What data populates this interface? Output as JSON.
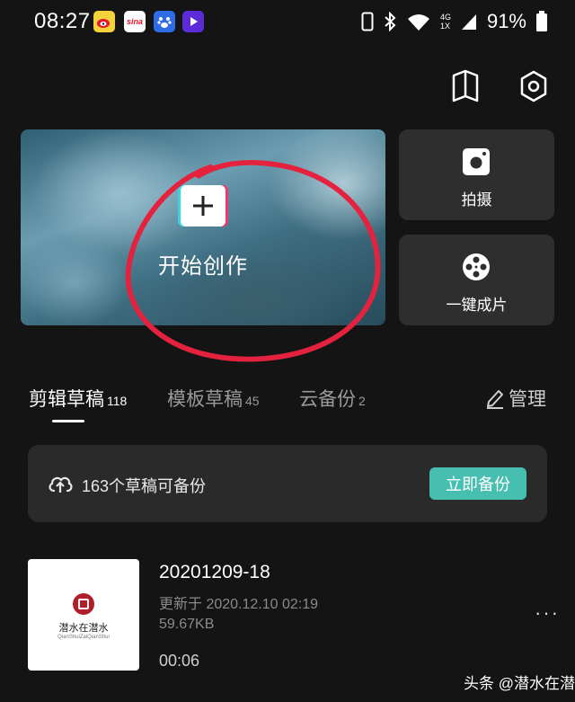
{
  "status_bar": {
    "time": "08:27",
    "battery": "91%",
    "network": "4G",
    "sim": "1X",
    "notifications": [
      "weibo-icon",
      "sina-icon",
      "baidu-icon",
      "video-app-icon"
    ],
    "sina_label": "sina"
  },
  "top_bar": {
    "icons": [
      "book-icon",
      "settings-icon"
    ]
  },
  "hero": {
    "label": "开始创作"
  },
  "actions": [
    {
      "label": "拍摄",
      "icon": "camera-icon"
    },
    {
      "label": "一键成片",
      "icon": "film-reel-icon"
    }
  ],
  "tabs": [
    {
      "label": "剪辑草稿",
      "count": "118",
      "active": true
    },
    {
      "label": "模板草稿",
      "count": "45",
      "active": false
    },
    {
      "label": "云备份",
      "count": "2",
      "active": false
    }
  ],
  "manage_label": "管理",
  "backup": {
    "text": "163个草稿可备份",
    "button": "立即备份"
  },
  "draft": {
    "name": "20201209-18",
    "updated": "更新于 2020.12.10 02:19",
    "size": "59.67KB",
    "duration": "00:06",
    "thumb_title": "潜水在潜水",
    "thumb_sub": "QianShuiZaiQianShui"
  },
  "more_label": "···",
  "watermark": "头条 @潜水在潜水",
  "colors": {
    "background": "#141414",
    "card": "#2e2e2e",
    "accent_teal": "#47bfb0",
    "annotation_red": "#e5223d"
  }
}
